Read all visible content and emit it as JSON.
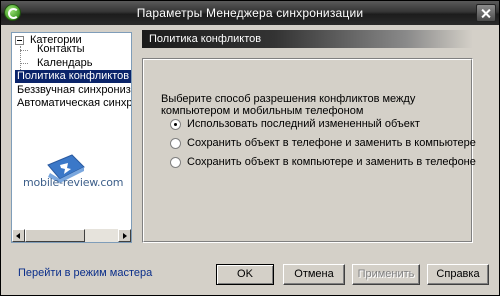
{
  "window": {
    "title": "Параметры Менеджера синхронизации"
  },
  "tree": {
    "items": [
      {
        "label": "Категории"
      },
      {
        "label": "Контакты"
      },
      {
        "label": "Календарь"
      },
      {
        "label": "Политика конфликтов"
      },
      {
        "label": "Беззвучная синхронизация"
      },
      {
        "label": "Автоматическая синхронизация"
      }
    ],
    "selected_index": 3,
    "watermark": "mobile-review.com"
  },
  "panel": {
    "header": "Политика конфликтов",
    "question": "Выберите способ разрешения конфликтов между компьютером и мобильным телефоном",
    "options": [
      {
        "label": "Использовать последний измененный объект",
        "checked": true
      },
      {
        "label": "Сохранить объект в телефоне и заменить в компьютере",
        "checked": false
      },
      {
        "label": "Сохранить объект в компьютере и заменить в телефоне",
        "checked": false
      }
    ]
  },
  "footer": {
    "master_link": "Перейти в режим мастера",
    "ok": "OK",
    "cancel": "Отмена",
    "apply": "Применить",
    "help": "Справка"
  }
}
